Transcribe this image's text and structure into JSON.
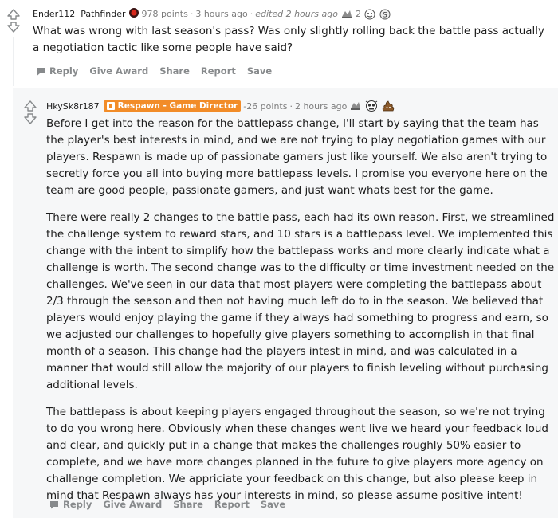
{
  "parent": {
    "username": "Ender112",
    "flair": "Pathfinder",
    "points": "978 points",
    "time": "3 hours ago",
    "edited": "edited 2 hours ago",
    "award_count": "2",
    "body": "What was wrong with last season's pass? Was only slightly rolling back the battle pass actually a negotiation tactic like some people have said?",
    "actions": {
      "reply": "Reply",
      "give_award": "Give Award",
      "share": "Share",
      "report": "Report",
      "save": "Save"
    }
  },
  "reply": {
    "username": "HkySk8r187",
    "flair": "Respawn - Game Director",
    "points": "-26 points",
    "time": "2 hours ago",
    "paragraphs": [
      "Before I get into the reason for the battlepass change, I'll start by saying that the team has the player's best interests in mind, and we are not trying to play negotiation games with our players. Respawn is made up of passionate gamers just like yourself. We also aren't trying to secretly force you all into buying more battlepass levels. I promise you everyone here on the team are good people, passionate gamers, and just want whats best for the game.",
      "There were really 2 changes to the battle pass, each had its own reason. First, we streamlined the challenge system to reward stars, and 10 stars is a battlepass level. We implemented this change with the intent to simplify how the battlepass works and more clearly indicate what a challenge is worth. The second change was to the difficulty or time investment needed on the challenges. We've seen in our data that most players were completing the battlepass about 2/3 through the season and then not having much left do to in the season. We believed that players would enjoy playing the game if they always had something to progress and earn, so we adjusted our challenges to hopefully give players something to accomplish in that final month of a season. This change had the players intest in mind, and was calculated in a manner that would still allow the majority of our players to finish leveling without purchasing additional levels.",
      "The battlepass is about keeping players engaged throughout the season, so we're not trying to do you wrong here. Obviously when these changes went live we heard your feedback loud and clear, and quickly put in a change that makes the challenges roughly 50% easier to complete, and we have more changes planned in the future to give players more agency on challenge completion. We appriciate your feedback on this change, but also please keep in mind that Respawn always has your interests in mind, so please assume positive intent!"
    ],
    "actions": {
      "reply": "Reply",
      "give_award": "Give Award",
      "share": "Share",
      "report": "Report",
      "save": "Save"
    }
  }
}
